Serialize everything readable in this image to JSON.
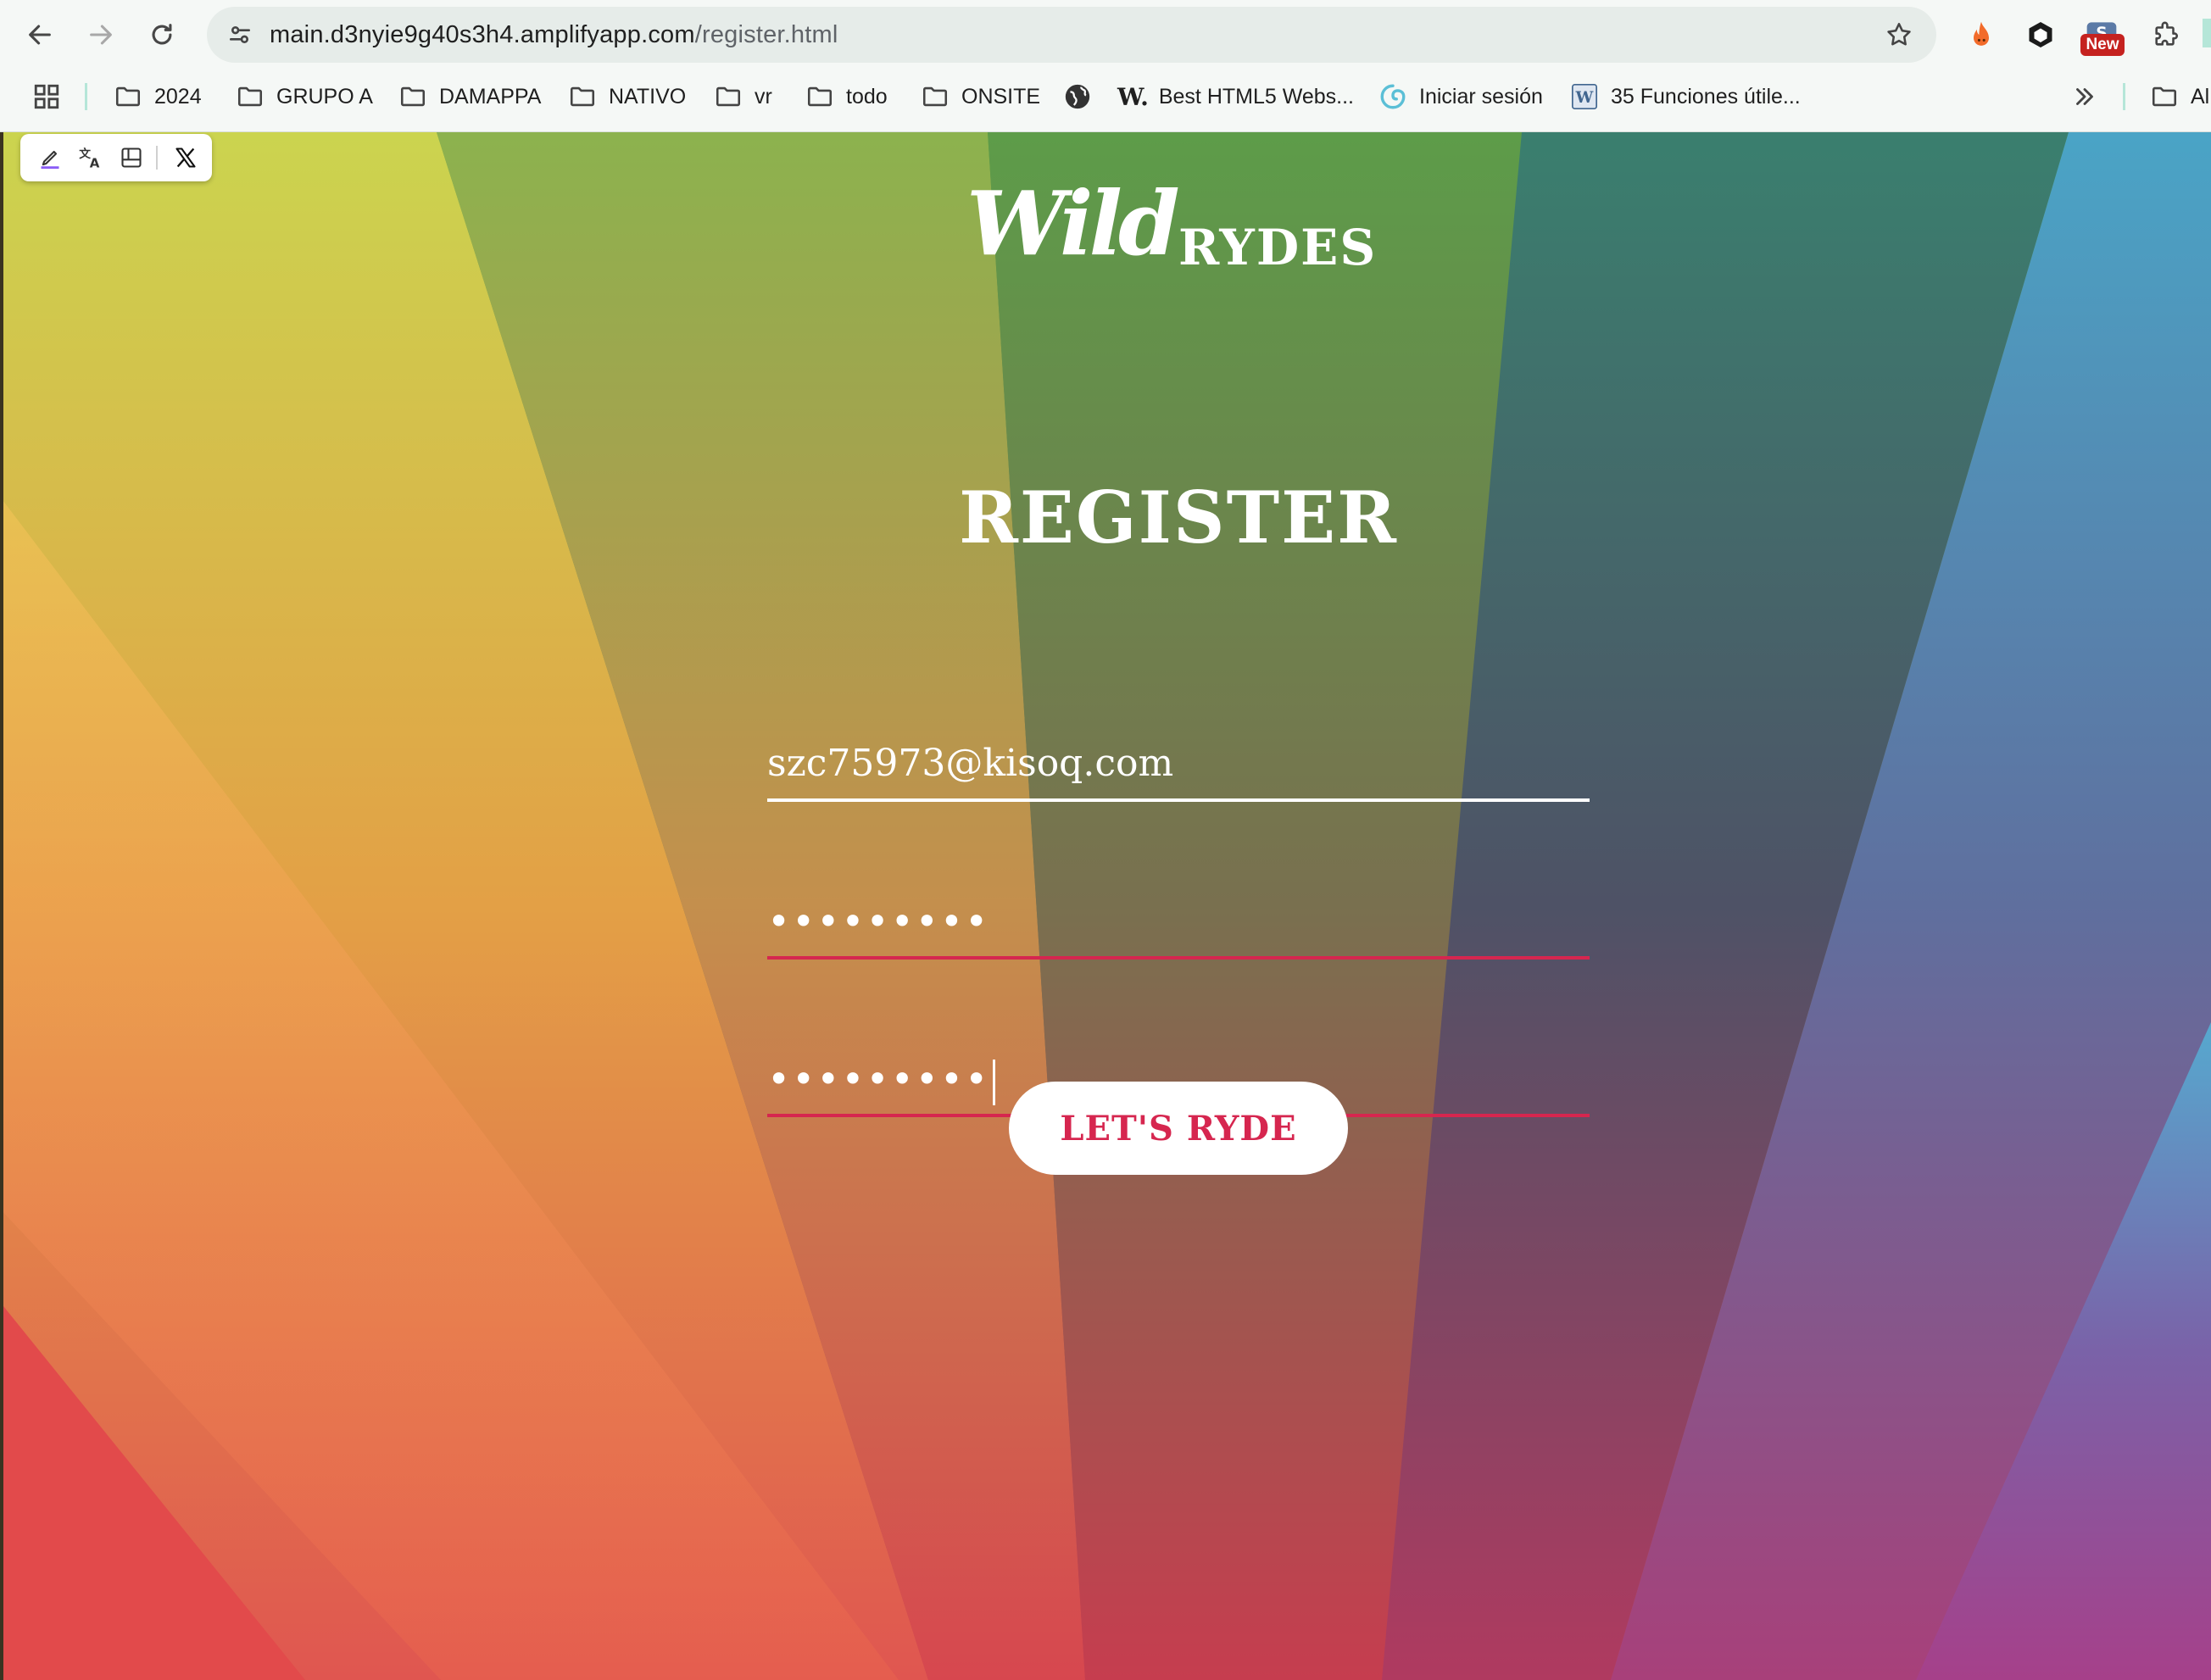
{
  "browser": {
    "url_host": "main.d3nyie9g40s3h4.amplifyapp.com",
    "url_path": "/register.html",
    "extension_badge": "New"
  },
  "bookmarks": [
    {
      "label": "2024",
      "icon": "folder-icon"
    },
    {
      "label": "GRUPO A",
      "icon": "folder-icon"
    },
    {
      "label": "DAMAPPA",
      "icon": "folder-icon"
    },
    {
      "label": "NATIVO",
      "icon": "folder-icon"
    },
    {
      "label": "vr",
      "icon": "folder-icon"
    },
    {
      "label": "todo",
      "icon": "folder-icon"
    },
    {
      "label": "ONSITE",
      "icon": "folder-icon"
    },
    {
      "label": "",
      "icon": "globe-icon"
    },
    {
      "label": "Best HTML5 Webs...",
      "icon": "w-logo-icon",
      "icon_text": "W."
    },
    {
      "label": "Iniciar sesión",
      "icon": "swirl-logo-icon"
    },
    {
      "label": "35 Funciones útile...",
      "icon": "wordpress-logo-icon"
    },
    {
      "label": "Al",
      "icon": "folder-icon"
    }
  ],
  "page": {
    "logo_script": "Wild",
    "logo_caps": "RYDES",
    "title": "REGISTER",
    "email_value": "szc75973@kisoq.com",
    "password_mask": "•••••••••",
    "confirm_mask": "•••••••••",
    "submit_label": "LET'S RYDE"
  },
  "colors": {
    "accent": "#d6264f",
    "chrome_bg": "#f5f8f6",
    "omnibox_bg": "#e6ece9"
  }
}
